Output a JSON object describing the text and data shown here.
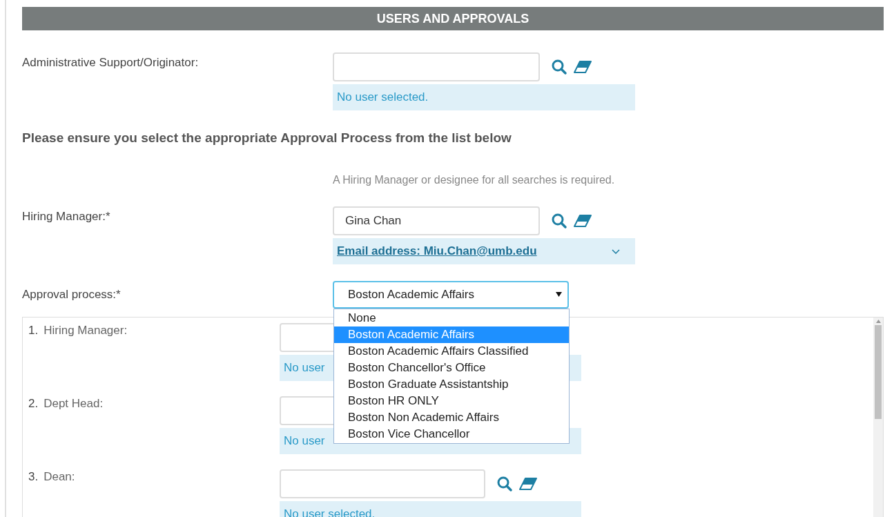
{
  "section_title": "USERS AND APPROVALS",
  "originator": {
    "label": "Administrative Support/Originator:",
    "status": "No user selected."
  },
  "instruction": "Please ensure you select the appropriate Approval Process from the list below",
  "hint": "A Hiring Manager or designee for all searches is required.",
  "hiring_manager": {
    "label": "Hiring Manager:*",
    "value": "Gina Chan",
    "email": "Email address: Miu.Chan@umb.edu",
    "expanded": false
  },
  "approval_process": {
    "label": "Approval process:*",
    "value": "Boston Academic Affairs",
    "open": true,
    "options": [
      {
        "label": "None",
        "selected": false
      },
      {
        "label": "Boston Academic Affairs",
        "selected": true
      },
      {
        "label": "Boston Academic Affairs Classified",
        "selected": false
      },
      {
        "label": "Boston Chancellor's Office",
        "selected": false
      },
      {
        "label": "Boston Graduate Assistantship",
        "selected": false
      },
      {
        "label": "Boston HR ONLY",
        "selected": false
      },
      {
        "label": "Boston Non Academic Affairs",
        "selected": false
      },
      {
        "label": "Boston Vice Chancellor",
        "selected": false
      }
    ]
  },
  "steps": [
    {
      "number": "1.",
      "label": "Hiring Manager:",
      "status": "No user"
    },
    {
      "number": "2.",
      "label": "Dept Head:",
      "status": "No user"
    },
    {
      "number": "3.",
      "label": "Dean:",
      "status": "No user selected."
    }
  ]
}
